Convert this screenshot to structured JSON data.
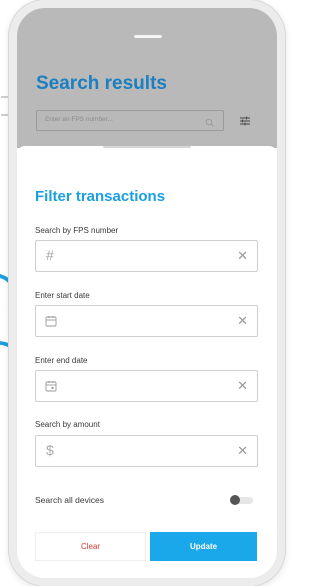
{
  "background": {
    "title": "Search results",
    "search_placeholder": "Enter an FPS number...",
    "icons": [
      "search-icon",
      "filter-sliders-icon"
    ]
  },
  "sheet": {
    "title": "Filter transactions",
    "fields": [
      {
        "label": "Search by FPS number",
        "leading": "#",
        "icon": "hash-icon"
      },
      {
        "label": "Enter start date",
        "leading": "",
        "icon": "calendar-icon"
      },
      {
        "label": "Enter end date",
        "leading": "",
        "icon": "calendar-icon"
      },
      {
        "label": "Search by amount",
        "leading": "$",
        "icon": "dollar-icon"
      }
    ],
    "clear_glyph": "✕",
    "toggle_label": "Search all devices",
    "toggle_on": false,
    "clear_button": "Clear",
    "update_button": "Update"
  },
  "colors": {
    "accent": "#1b9fe0",
    "title_dim": "#1b7fc0",
    "update_bg": "#1ba8ea",
    "clear_text": "#d63b3b"
  }
}
